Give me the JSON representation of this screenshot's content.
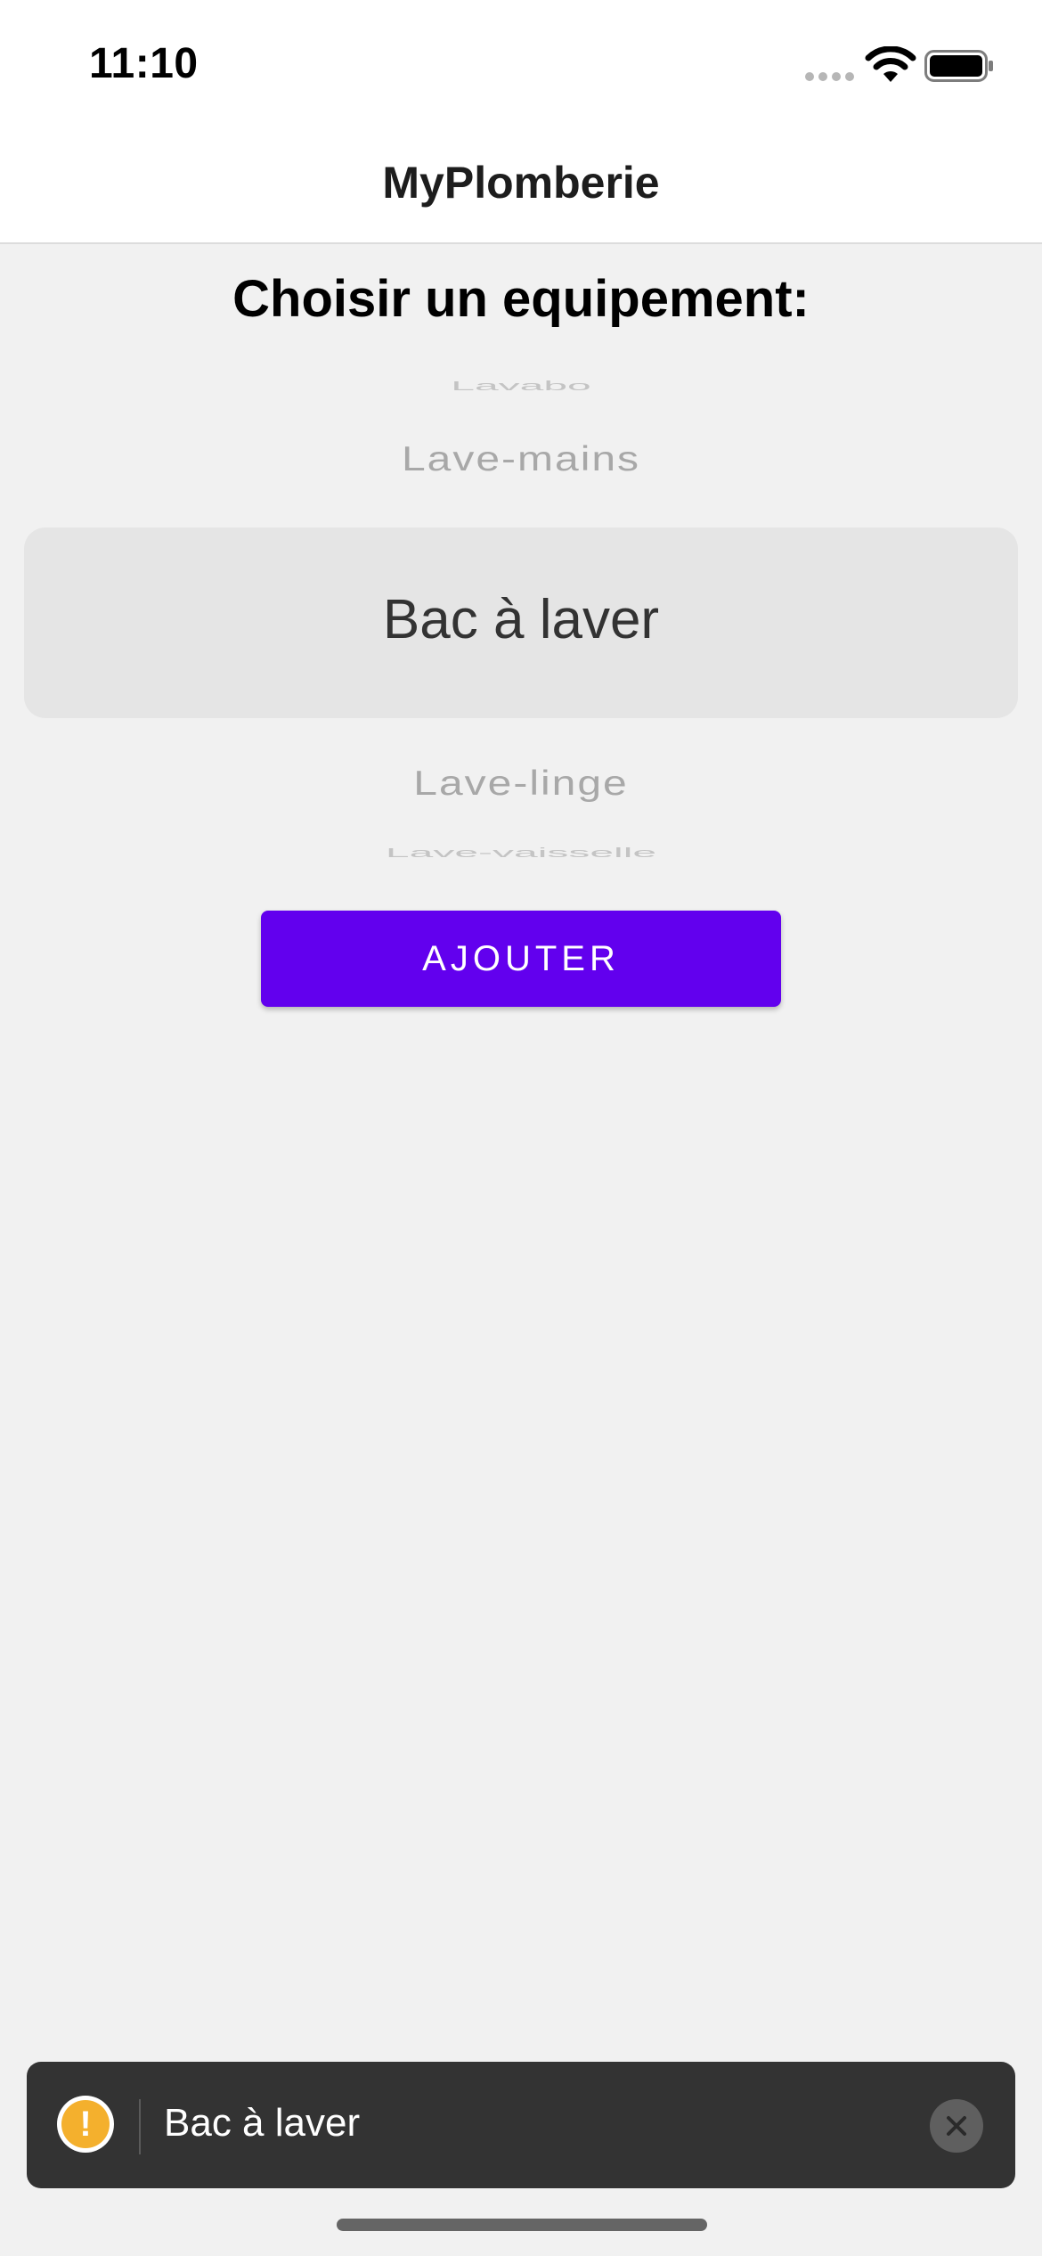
{
  "status_bar": {
    "time": "11:10"
  },
  "header": {
    "title": "MyPlomberie"
  },
  "main": {
    "section_title": "Choisir un equipement:",
    "picker": {
      "items": [
        {
          "label": "Lavabo",
          "state": "far"
        },
        {
          "label": "Lave-mains",
          "state": "near"
        },
        {
          "label": "Bac à laver",
          "state": "selected"
        },
        {
          "label": "Lave-linge",
          "state": "near"
        },
        {
          "label": "Lave-vaisselle",
          "state": "far"
        }
      ],
      "selected_value": "Bac à laver"
    },
    "add_button_label": "AJOUTER"
  },
  "toast": {
    "icon": "warning-icon",
    "icon_glyph": "!",
    "message": "Bac à laver",
    "close_icon": "close-icon"
  },
  "colors": {
    "accent": "#6200ee",
    "toast_background": "#333333",
    "warning": "#f4b02d"
  }
}
